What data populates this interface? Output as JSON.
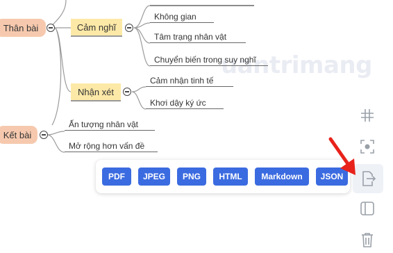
{
  "mindmap": {
    "root_nodes": [
      {
        "label": "Thân bài"
      },
      {
        "label": "Kết bài"
      }
    ],
    "topics": [
      {
        "label": "Cảm nghĩ",
        "children": [
          "Không gian",
          "Tâm trạng nhân vật",
          "Chuyển biến trong suy nghĩ"
        ]
      },
      {
        "label": "Nhận xét",
        "children": [
          "Cảm nhận tinh tế",
          "Khơi dậy ký ức"
        ]
      }
    ],
    "ket_bai_children": [
      "Ấn tượng nhân vật",
      "Mở rộng hơn vấn đề"
    ]
  },
  "export_menu": {
    "buttons": [
      "PDF",
      "JPEG",
      "PNG",
      "HTML",
      "Markdown",
      "JSON"
    ]
  },
  "right_toolbar": {
    "items": [
      {
        "icon": "grid-icon"
      },
      {
        "icon": "focus-icon"
      },
      {
        "icon": "export-icon",
        "active": true
      },
      {
        "icon": "panel-icon"
      },
      {
        "icon": "trash-icon"
      }
    ]
  },
  "watermark": {
    "text": "uantrimang"
  },
  "colors": {
    "root_bg": "#f6c9ae",
    "topic_bg": "#fde9a7",
    "button_blue": "#3b6be0",
    "arrow_red": "#e8221b",
    "line": "#999999"
  }
}
